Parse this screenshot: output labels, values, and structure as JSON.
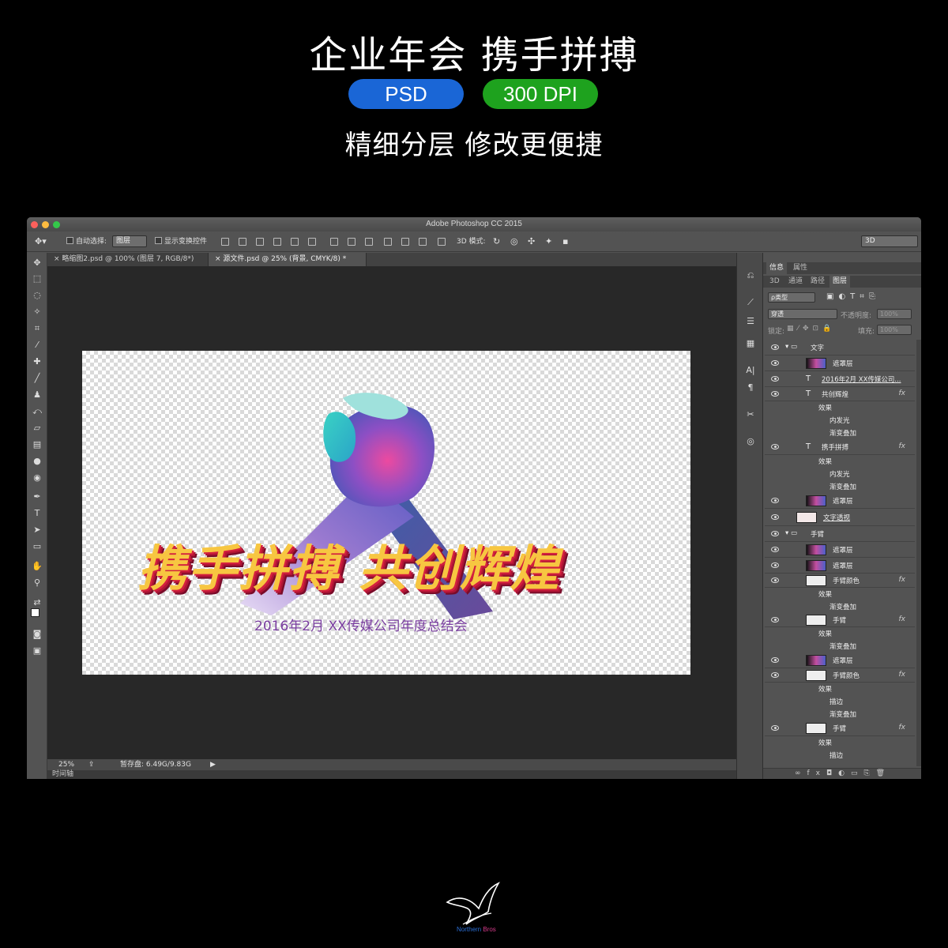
{
  "promo": {
    "title": "企业年会 携手拼搏",
    "badge_psd": "PSD",
    "badge_dpi": "300 DPI",
    "subtitle": "精细分层  修改更便捷"
  },
  "window": {
    "title": "Adobe Photoshop CC 2015"
  },
  "options_bar": {
    "auto_select_label": "自动选择:",
    "auto_select_value": "图层",
    "show_transform_label": "显示变换控件",
    "mode_3d_label": "3D 模式:",
    "workspace_value": "3D"
  },
  "tabs": [
    {
      "label": "略缩图2.psd @ 100% (图层 7, RGB/8*)"
    },
    {
      "label": "源文件.psd @ 25% (背景, CMYK/8) *"
    }
  ],
  "canvas": {
    "headline": "携手拼搏 共创辉煌",
    "subline": "2016年2月 XX传媒公司年度总结会"
  },
  "status": {
    "zoom": "25%",
    "scratch": "暂存盘: 6.49G/9.83G",
    "timeline": "时间轴"
  },
  "panels": {
    "top_tabs": [
      "信息",
      "属性"
    ],
    "layer_tabs": [
      "3D",
      "通道",
      "路径",
      "图层"
    ],
    "filter_label": "ρ类型",
    "blend_mode": "穿透",
    "opacity_label": "不透明度:",
    "opacity_value": "100%",
    "lock_label": "锁定:",
    "fill_label": "填充:",
    "fill_value": "100%"
  },
  "layers": [
    {
      "name": "文字"
    },
    {
      "name": "遮罩层"
    },
    {
      "name": "2016年2月 XX传媒公司..."
    },
    {
      "name": "共创辉煌"
    },
    {
      "name": "效果"
    },
    {
      "name": "内发光"
    },
    {
      "name": "渐变叠加"
    },
    {
      "name": "携手拼搏"
    },
    {
      "name": "效果"
    },
    {
      "name": "内发光"
    },
    {
      "name": "渐变叠加"
    },
    {
      "name": "遮罩层"
    },
    {
      "name": "文字透视"
    },
    {
      "name": "手臂"
    },
    {
      "name": "遮罩层"
    },
    {
      "name": "遮罩层"
    },
    {
      "name": "手臂颜色"
    },
    {
      "name": "效果"
    },
    {
      "name": "渐变叠加"
    },
    {
      "name": "手臂"
    },
    {
      "name": "效果"
    },
    {
      "name": "渐变叠加"
    },
    {
      "name": "遮罩层"
    },
    {
      "name": "手臂颜色"
    },
    {
      "name": "效果"
    },
    {
      "name": "描边"
    },
    {
      "name": "渐变叠加"
    },
    {
      "name": "手臂"
    },
    {
      "name": "效果"
    },
    {
      "name": "描边"
    }
  ],
  "fx_label": "fx",
  "logo": {
    "text_a": "Northern",
    "text_b": "Bros"
  }
}
